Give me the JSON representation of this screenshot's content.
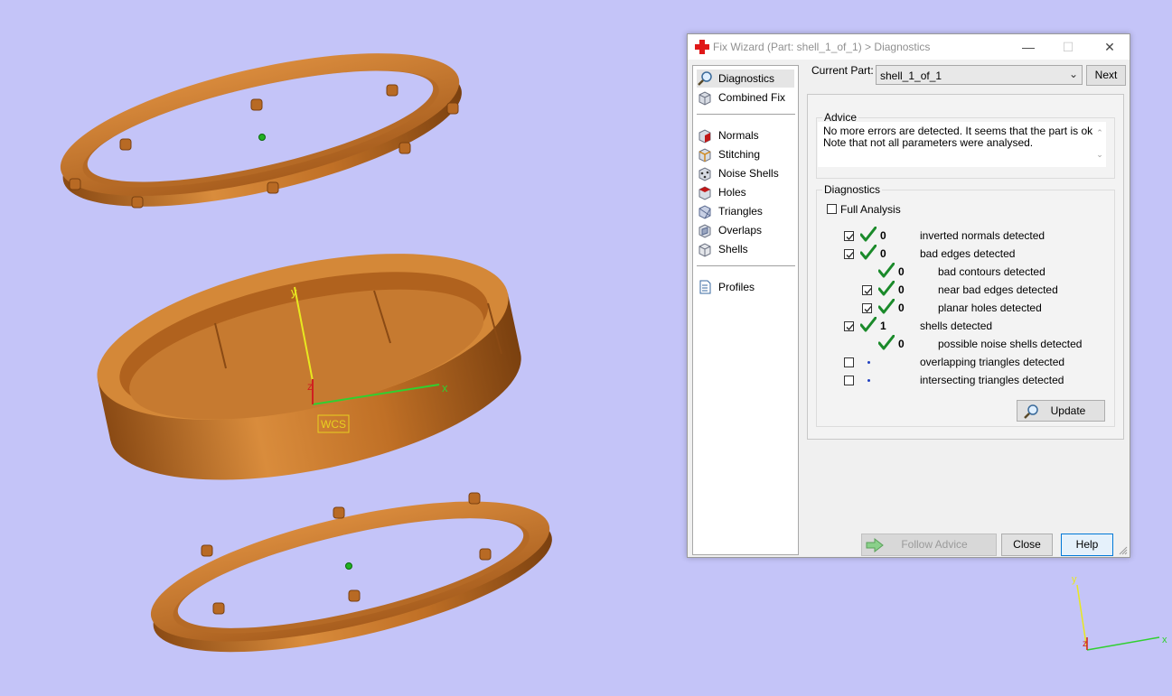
{
  "viewport": {
    "wcs_label": "WCS",
    "main_axes": {
      "y": "y",
      "z": "z",
      "x": "x"
    },
    "mini_axes": {
      "y": "y",
      "z": "z",
      "x": "x"
    },
    "background": "#c4c4f8",
    "part_color": "#c87a30"
  },
  "dialog": {
    "title": "Fix Wizard (Part: shell_1_of_1) > Diagnostics",
    "controls": {
      "minimize": "—",
      "maximize": "☐",
      "close": "✕"
    },
    "nav": {
      "top": [
        {
          "label": "Diagnostics",
          "icon": "magnifier-icon",
          "selected": true
        },
        {
          "label": "Combined Fix",
          "icon": "cube-icon"
        }
      ],
      "tools": [
        {
          "label": "Normals",
          "icon": "normals-icon"
        },
        {
          "label": "Stitching",
          "icon": "stitching-icon"
        },
        {
          "label": "Noise Shells",
          "icon": "noise-shells-icon"
        },
        {
          "label": "Holes",
          "icon": "holes-icon"
        },
        {
          "label": "Triangles",
          "icon": "triangles-icon"
        },
        {
          "label": "Overlaps",
          "icon": "overlaps-icon"
        },
        {
          "label": "Shells",
          "icon": "shells-icon"
        }
      ],
      "bottom": [
        {
          "label": "Profiles",
          "icon": "document-icon"
        }
      ]
    },
    "current_part_label": "Current Part:",
    "current_part_value": "shell_1_of_1",
    "next_label": "Next",
    "advice": {
      "title": "Advice",
      "text": "No more errors are detected. It seems that the part is ok. Note that not all parameters were analysed."
    },
    "diagnostics": {
      "title": "Diagnostics",
      "full_analysis_label": "Full Analysis",
      "full_analysis_checked": false,
      "rows": [
        {
          "checkbox": true,
          "checked": true,
          "status": "check",
          "count": "0",
          "label": "inverted normals detected",
          "indent": 0
        },
        {
          "checkbox": true,
          "checked": true,
          "status": "check",
          "count": "0",
          "label": "bad edges detected",
          "indent": 0
        },
        {
          "checkbox": false,
          "checked": false,
          "status": "check",
          "count": "0",
          "label": "bad contours detected",
          "indent": 1
        },
        {
          "checkbox": true,
          "checked": true,
          "status": "check",
          "count": "0",
          "label": "near bad edges detected",
          "indent": 1
        },
        {
          "checkbox": true,
          "checked": true,
          "status": "check",
          "count": "0",
          "label": "planar holes detected",
          "indent": 1
        },
        {
          "checkbox": true,
          "checked": true,
          "status": "check",
          "count": "1",
          "label": "shells detected",
          "indent": 0
        },
        {
          "checkbox": false,
          "checked": false,
          "status": "check",
          "count": "0",
          "label": "possible noise shells detected",
          "indent": 1
        },
        {
          "checkbox": true,
          "checked": false,
          "status": "dot",
          "count": "",
          "label": "overlapping triangles detected",
          "indent": 0
        },
        {
          "checkbox": true,
          "checked": false,
          "status": "dot",
          "count": "",
          "label": "intersecting triangles detected",
          "indent": 0
        }
      ],
      "update_label": "Update"
    },
    "footer": {
      "follow_advice_label": "Follow Advice",
      "close_label": "Close",
      "help_label": "Help"
    }
  }
}
